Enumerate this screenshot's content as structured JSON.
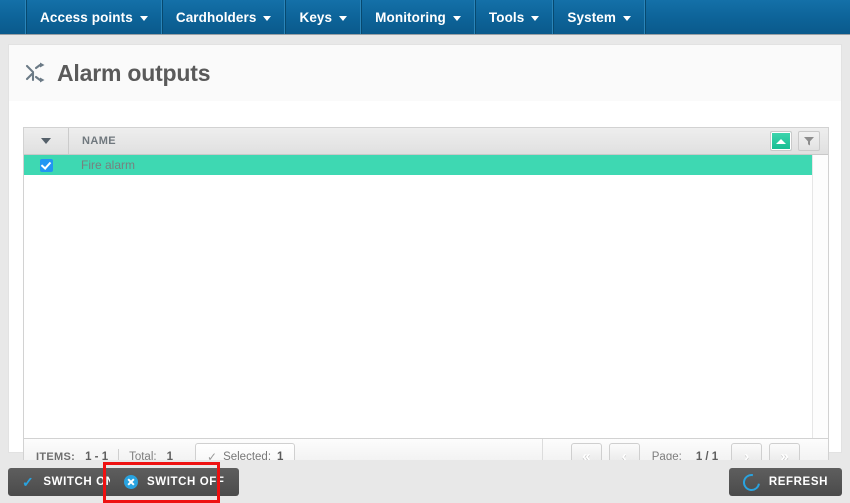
{
  "nav": {
    "items": [
      {
        "label": "Access points",
        "icon": "chevron-down-icon"
      },
      {
        "label": "Cardholders",
        "icon": "chevron-down-icon"
      },
      {
        "label": "Keys",
        "icon": "chevron-down-icon"
      },
      {
        "label": "Monitoring",
        "icon": "chevron-down-icon"
      },
      {
        "label": "Tools",
        "icon": "chevron-down-icon"
      },
      {
        "label": "System",
        "icon": "chevron-down-icon"
      }
    ]
  },
  "page": {
    "title": "Alarm outputs",
    "icon": "shuffle-icon"
  },
  "grid": {
    "select_all_icon": "chevron-down-icon",
    "columns": [
      "NAME"
    ],
    "sort_button_icon": "caret-up-icon",
    "filter_button_icon": "funnel-icon",
    "rows": [
      {
        "name": "Fire alarm",
        "selected": true
      }
    ]
  },
  "grid_footer": {
    "items_label": "ITEMS:",
    "items_range": "1 - 1",
    "total_label": "Total:",
    "total_value": "1",
    "selected_label": "Selected:",
    "selected_value": "1",
    "selected_icon": "check-icon",
    "pagination": {
      "first_label": "«",
      "prev_label": "‹",
      "page_label": "Page:",
      "page_value": "1 / 1",
      "next_label": "›",
      "last_label": "»"
    }
  },
  "actions": {
    "switch_on": {
      "label": "SWITCH ON",
      "icon": "check-icon"
    },
    "switch_off": {
      "label": "SWITCH OFF",
      "icon": "circle-x-icon"
    },
    "refresh": {
      "label": "REFRESH",
      "icon": "refresh-icon"
    }
  },
  "colors": {
    "nav_blue": "#0d6398",
    "row_selected_teal": "#3ed8b2",
    "accent_blue": "#29a3e0",
    "sort_green": "#16bd92",
    "highlight_red": "#ee1111",
    "button_dark": "#4b4b4b"
  }
}
